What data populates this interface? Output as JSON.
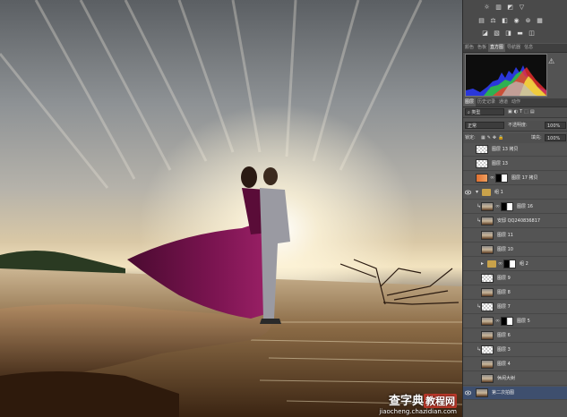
{
  "adjustments": {
    "row1": [
      "sun-icon",
      "brightness-icon",
      "curves-icon",
      "triangle-icon"
    ],
    "row2": [
      "levels-icon",
      "balance-icon",
      "bw-icon",
      "photo-filter-icon",
      "mixer-icon",
      "grid-icon"
    ],
    "row3": [
      "invert-icon",
      "posterize-icon",
      "threshold-icon",
      "gradient-map-icon",
      "selective-color-icon"
    ]
  },
  "panel_tabs_top": [
    "颜色",
    "色板",
    "直方图",
    "导航器",
    "信息"
  ],
  "panel_tabs_top_active": 2,
  "panel_tabs_layers": [
    "图层",
    "历史记录",
    "通道",
    "动作"
  ],
  "panel_tabs_layers_active": 0,
  "filter": {
    "type_label": "类型"
  },
  "blend": {
    "mode": "正常",
    "opacity_label": "不透明度:",
    "opacity": "100%"
  },
  "lock": {
    "label": "锁定:",
    "fill_label": "填充:",
    "fill": "100%"
  },
  "layers": [
    {
      "name": "图层 13 拷贝",
      "thumb": "chk",
      "visible": false
    },
    {
      "name": "图层 13",
      "thumb": "chk",
      "visible": false
    },
    {
      "name": "图层 17 拷贝",
      "thumb": "orange",
      "mask": true,
      "visible": false
    },
    {
      "name": "组 1",
      "group": true,
      "expanded": true,
      "visible": true
    },
    {
      "name": "图层 16",
      "thumb": "photo",
      "mask": true,
      "clip": true,
      "visible": false,
      "indent": 1
    },
    {
      "name": "安邸 QQ240836817",
      "thumb": "photo",
      "clip": true,
      "visible": false,
      "indent": 1
    },
    {
      "name": "图层 11",
      "thumb": "photo",
      "visible": false,
      "indent": 1
    },
    {
      "name": "图层 10",
      "thumb": "photo",
      "visible": false,
      "indent": 1
    },
    {
      "name": "组 2",
      "group": true,
      "expanded": false,
      "mask": true,
      "visible": false,
      "indent": 1
    },
    {
      "name": "图层 9",
      "thumb": "chk",
      "visible": false,
      "indent": 1
    },
    {
      "name": "图层 8",
      "thumb": "photo",
      "visible": false,
      "indent": 1
    },
    {
      "name": "图层 7",
      "thumb": "chk",
      "clip": true,
      "visible": false,
      "indent": 1
    },
    {
      "name": "图层 5",
      "thumb": "photo",
      "mask": true,
      "visible": false,
      "indent": 1
    },
    {
      "name": "图层 6",
      "thumb": "photo",
      "visible": false,
      "indent": 1
    },
    {
      "name": "图层 3",
      "thumb": "chk",
      "clip": true,
      "visible": false,
      "indent": 1
    },
    {
      "name": "图层 4",
      "thumb": "photo",
      "visible": false,
      "indent": 1
    },
    {
      "name": "休闲大树",
      "thumb": "photo",
      "visible": false,
      "indent": 1
    },
    {
      "name": "第二次拍图",
      "thumb": "photo",
      "visible": true,
      "selected": true
    }
  ],
  "watermark": {
    "text1": "查字典",
    "text2": "教程网",
    "url": "jiaocheng.chazidian.com"
  },
  "colors": {
    "panel_bg": "#535353",
    "selected": "#3e4f6e",
    "dress": "#7a1450",
    "watermark_red": "#c03a2b"
  }
}
